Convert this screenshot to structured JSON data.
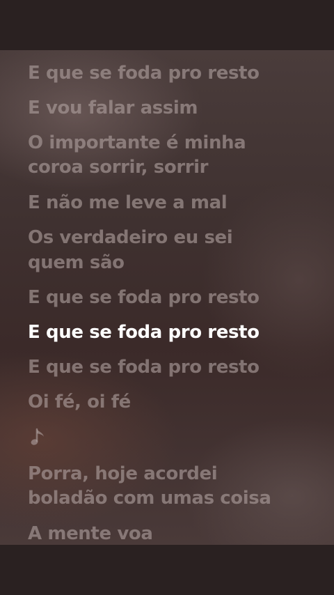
{
  "lyrics": {
    "lines": [
      {
        "text": "E que se foda pro resto"
      },
      {
        "text": "E vou falar assim"
      },
      {
        "text": "O importante é minha"
      },
      {
        "text": "coroa sorrir, sorrir"
      },
      {
        "text": "E não me leve a mal"
      },
      {
        "text": "Os verdadeiro eu sei"
      },
      {
        "text": "quem são"
      },
      {
        "text": "E que se foda pro resto"
      },
      {
        "text": "E que se foda pro resto"
      },
      {
        "text": "E que se foda pro resto"
      },
      {
        "text": "Oi fé, oi fé"
      },
      {
        "text": "Porra, hoje acordei"
      },
      {
        "text": "boladão com umas coisa"
      },
      {
        "text": "A mente voa"
      }
    ],
    "current_line_index": 8,
    "instrumental_icon": "music-note-icon"
  },
  "colors": {
    "active_line": "#ffffff",
    "inactive_line": "rgba(175,160,158,0.62)",
    "bars": "#2a2121"
  }
}
